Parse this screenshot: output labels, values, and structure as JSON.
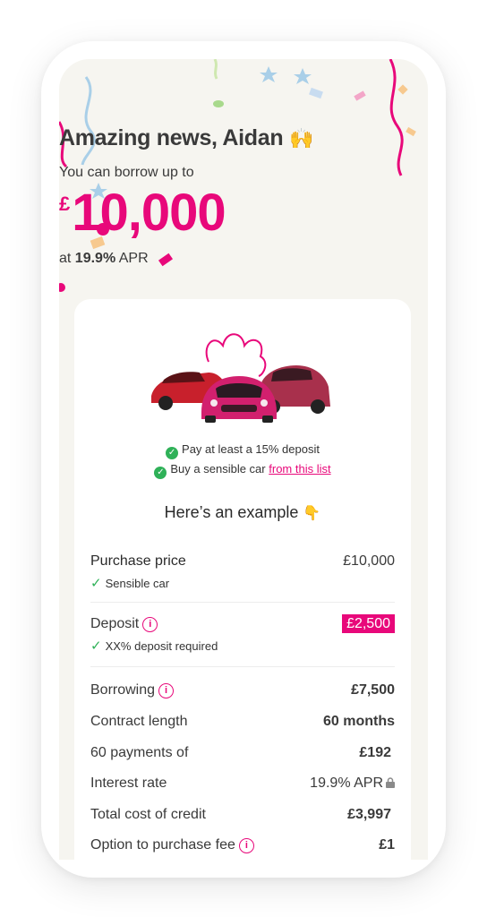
{
  "hero": {
    "headline": "Amazing news, Aidan",
    "headline_emoji": "🙌",
    "subline": "You can borrow up to",
    "currency": "£",
    "amount": "10,000",
    "apr_prefix": "at",
    "apr_value": "19.9%",
    "apr_suffix": "APR"
  },
  "conditions": {
    "deposit": "Pay at least a 15% deposit",
    "car_prefix": "Buy a sensible car",
    "car_link": "from this list"
  },
  "example": {
    "title": "Here’s an example",
    "title_emoji": "👇",
    "purchase_price_label": "Purchase price",
    "purchase_price_value": "£10,000",
    "purchase_price_note": "Sensible car",
    "deposit_label": "Deposit",
    "deposit_value": "£2,500",
    "deposit_note": "XX% deposit required",
    "rows": [
      {
        "label": "Borrowing",
        "value": "£7,500",
        "info": true
      },
      {
        "label": "Contract length",
        "value": "60 months",
        "info": false
      },
      {
        "label": "60 payments of",
        "value": "£192",
        "info": false
      },
      {
        "label": "Interest rate",
        "value": "19.9% APR",
        "info": false
      },
      {
        "label": "Total cost of credit",
        "value": "£3,997",
        "info": false
      },
      {
        "label": "Option to purchase fee",
        "value": "£1",
        "info": true
      }
    ]
  },
  "colors": {
    "accent": "#e8087a",
    "success": "#2fb158",
    "background": "#f6f5f0"
  },
  "icons": {
    "check": "check-icon",
    "info": "info-icon",
    "lock": "lock-icon"
  }
}
